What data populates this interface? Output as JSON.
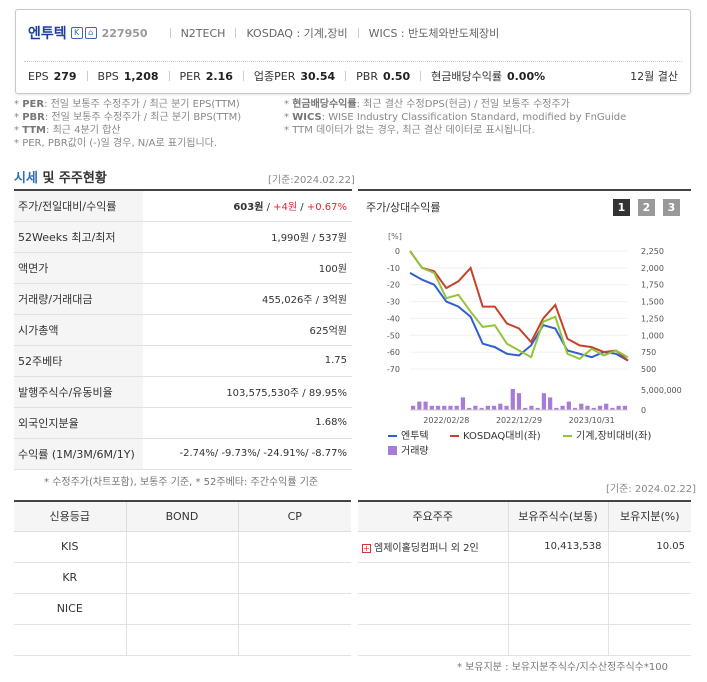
{
  "header": {
    "name": "엔투텍",
    "code": "227950",
    "ticker": "N2TECH",
    "market": "KOSDAQ : 기계,장비",
    "wics": "WICS : 반도체와반도체장비",
    "metrics": [
      {
        "label": "EPS",
        "value": "279"
      },
      {
        "label": "BPS",
        "value": "1,208"
      },
      {
        "label": "PER",
        "value": "2.16"
      },
      {
        "label": "업종PER",
        "value": "30.54"
      },
      {
        "label": "PBR",
        "value": "0.50"
      },
      {
        "label": "현금배당수익률",
        "value": "0.00%"
      }
    ],
    "fiscal": "12월 결산"
  },
  "notes": {
    "left": [
      {
        "k": "PER",
        "t": ": 전일 보통주 수정주가 / 최근 분기 EPS(TTM)"
      },
      {
        "k": "PBR",
        "t": ": 전일 보통주 수정주가 / 최근 분기 BPS(TTM)"
      },
      {
        "k": "TTM",
        "t": ": 최근 4분기 합산"
      },
      {
        "k": "",
        "t": "PER, PBR값이 (-)일 경우, N/A로 표기됩니다."
      }
    ],
    "right": [
      {
        "k": "현금배당수익률",
        "t": ": 최근 결산 수정DPS(현금) / 전일 보통주 수정주가"
      },
      {
        "k": "WICS",
        "t": ": WISE Industry Classification Standard, modified by FnGuide"
      },
      {
        "k": "",
        "t": "TTM 데이터가 없는 경우, 최근 결산 데이터로 표시됩니다."
      }
    ]
  },
  "section": {
    "title_a": "시세",
    "title_b": " 및 주주현황",
    "date": "[기준:2024.02.22]"
  },
  "quote": {
    "price_row": {
      "label": "주가/전일대비/수익률",
      "price": "603원",
      "sep1": " / ",
      "chg": "+4원",
      "sep2": " / ",
      "pct": "+0.67%"
    },
    "rows": [
      {
        "label": "52Weeks 최고/최저",
        "value": "1,990원 / 537원"
      },
      {
        "label": "액면가",
        "value": "100원"
      },
      {
        "label": "거래량/거래대금",
        "value": "455,026주 / 3억원"
      },
      {
        "label": "시가총액",
        "value": "625억원"
      },
      {
        "label": "52주베타",
        "value": "1.75"
      },
      {
        "label": "발행주식수/유동비율",
        "value": "103,575,530주 / 89.95%"
      },
      {
        "label": "외국인지분율",
        "value": "1.68%"
      }
    ],
    "return_row": {
      "label": "수익률 (1M/3M/6M/1Y)",
      "value": "-2.74%/ -9.73%/ -24.91%/ -8.77%"
    },
    "footnote": "* 수정주가(차트포함), 보통주 기준, * 52주베타: 주간수익률 기준"
  },
  "chart": {
    "title": "주가/상대수익률",
    "pages": [
      "1",
      "2",
      "3"
    ],
    "colors": {
      "stock": "#2f5fd0",
      "kosdaq": "#c8412a",
      "sector": "#94c43c",
      "volume": "#a77cd6"
    },
    "legend": [
      "엔투텍",
      "KOSDAQ대비(좌)",
      "기계,장비대비(좌)",
      "거래량"
    ]
  },
  "chart_data": {
    "type": "line",
    "ylabel_left": "[%]",
    "y_left_ticks": [
      "0",
      "-10",
      "-20",
      "-30",
      "-40",
      "-50",
      "-60",
      "-70"
    ],
    "ylim_left": [
      -70,
      0
    ],
    "y_right_ticks": [
      "2,250",
      "2,000",
      "1,750",
      "1,500",
      "1,250",
      "1,000",
      "750",
      "500"
    ],
    "ylim_right": [
      500,
      2250
    ],
    "volume_tick": "5,000,000",
    "x_ticks": [
      "2022/02/28",
      "2022/12/29",
      "2023/10/31"
    ],
    "series": [
      {
        "name": "엔투텍",
        "values": [
          -13,
          -17,
          -20,
          -30,
          -33,
          -39,
          -55,
          -57,
          -61,
          -62,
          -56,
          -44,
          -46,
          -59,
          -61,
          -63,
          -60,
          -61,
          -65
        ]
      },
      {
        "name": "KOSDAQ대비(좌)",
        "values": [
          0,
          -10,
          -12,
          -22,
          -18,
          -10,
          -33,
          -33,
          -43,
          -46,
          -54,
          -40,
          -32,
          -52,
          -56,
          -57,
          -60,
          -59,
          -65
        ]
      },
      {
        "name": "기계,장비대비(좌)",
        "values": [
          0,
          -10,
          -13,
          -28,
          -26,
          -36,
          -45,
          -44,
          -55,
          -59,
          -63,
          -42,
          -39,
          -61,
          -64,
          -58,
          -62,
          -59,
          -63
        ]
      }
    ],
    "volume": [
      1,
      2,
      2,
      1,
      1,
      1,
      1,
      1,
      3,
      0.5,
      1,
      0.5,
      1,
      1,
      1.5,
      1,
      5,
      4,
      0.5,
      1,
      0.5,
      4,
      3,
      0.5,
      1,
      2,
      0.5,
      1.5,
      1,
      0.5,
      1,
      1.5,
      0.5,
      1,
      1
    ]
  },
  "credit": {
    "date": "[기준: 2024.02.22]",
    "headers": [
      "신용등급",
      "BOND",
      "CP"
    ],
    "rows": [
      "KIS",
      "KR",
      "NICE",
      ""
    ]
  },
  "holders": {
    "headers": [
      "주요주주",
      "보유주식수(보통)",
      "보유지분(%)"
    ],
    "rows": [
      {
        "name": "엠제이홀딩컴퍼니 외 2인",
        "shares": "10,413,538",
        "pct": "10.05"
      }
    ],
    "footnote": "* 보유지분 : 보유지분주식수/지수산정주식수*100"
  }
}
